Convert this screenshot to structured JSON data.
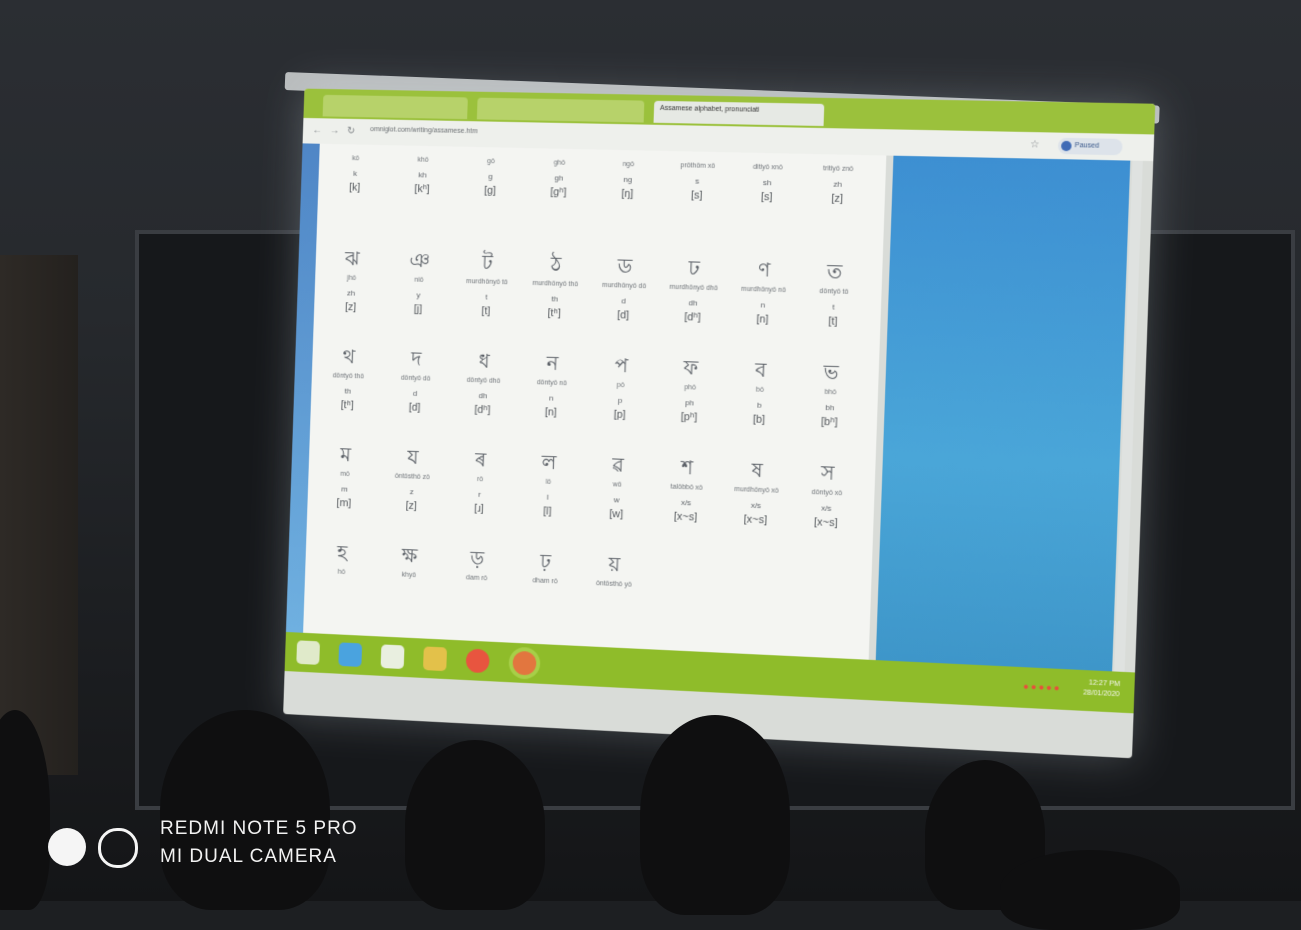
{
  "browser": {
    "tabs": [
      {
        "label": ""
      },
      {
        "label": ""
      },
      {
        "label": "Assamese alphabet, pronunciati"
      }
    ],
    "url": "omniglot.com/writing/assamese.htm",
    "profile_label": "Paused"
  },
  "alphabet_rows": [
    [
      {
        "glyph": "",
        "name": "kô",
        "roman": "k",
        "ipa": "[k]"
      },
      {
        "glyph": "",
        "name": "khô",
        "roman": "kh",
        "ipa": "[kʰ]"
      },
      {
        "glyph": "",
        "name": "gô",
        "roman": "g",
        "ipa": "[g]"
      },
      {
        "glyph": "",
        "name": "ghô",
        "roman": "gh",
        "ipa": "[gʰ]"
      },
      {
        "glyph": "",
        "name": "ngô",
        "roman": "ng",
        "ipa": "[ŋ]"
      },
      {
        "glyph": "",
        "name": "prôthôm xô",
        "roman": "s",
        "ipa": "[s]"
      },
      {
        "glyph": "",
        "name": "ditiyô xnô",
        "roman": "sh",
        "ipa": "[s]"
      },
      {
        "glyph": "",
        "name": "tritiyô znô",
        "roman": "zh",
        "ipa": "[z]"
      }
    ],
    [
      {
        "glyph": "ঝ",
        "name": "jhô",
        "roman": "zh",
        "ipa": "[z]"
      },
      {
        "glyph": "ঞ",
        "name": "niô",
        "roman": "y",
        "ipa": "[j]"
      },
      {
        "glyph": "ট",
        "name": "murdhônyô tô",
        "roman": "t",
        "ipa": "[t]"
      },
      {
        "glyph": "ঠ",
        "name": "murdhônyô thô",
        "roman": "th",
        "ipa": "[tʰ]"
      },
      {
        "glyph": "ড",
        "name": "murdhônyô dô",
        "roman": "d",
        "ipa": "[d]"
      },
      {
        "glyph": "ঢ",
        "name": "murdhônyô dhô",
        "roman": "dh",
        "ipa": "[dʰ]"
      },
      {
        "glyph": "ণ",
        "name": "murdhônyô nô",
        "roman": "n",
        "ipa": "[n]"
      },
      {
        "glyph": "ত",
        "name": "dôntyô tô",
        "roman": "t",
        "ipa": "[t]"
      }
    ],
    [
      {
        "glyph": "থ",
        "name": "dôntyô thô",
        "roman": "th",
        "ipa": "[tʰ]"
      },
      {
        "glyph": "দ",
        "name": "dôntyô dô",
        "roman": "d",
        "ipa": "[d]"
      },
      {
        "glyph": "ধ",
        "name": "dôntyô dhô",
        "roman": "dh",
        "ipa": "[dʰ]"
      },
      {
        "glyph": "ন",
        "name": "dôntyô nô",
        "roman": "n",
        "ipa": "[n]"
      },
      {
        "glyph": "প",
        "name": "pô",
        "roman": "p",
        "ipa": "[p]"
      },
      {
        "glyph": "ফ",
        "name": "phô",
        "roman": "ph",
        "ipa": "[pʰ]"
      },
      {
        "glyph": "ব",
        "name": "bô",
        "roman": "b",
        "ipa": "[b]"
      },
      {
        "glyph": "ভ",
        "name": "bhô",
        "roman": "bh",
        "ipa": "[bʰ]"
      }
    ],
    [
      {
        "glyph": "ম",
        "name": "mô",
        "roman": "m",
        "ipa": "[m]"
      },
      {
        "glyph": "য",
        "name": "ôntôsthô zô",
        "roman": "z",
        "ipa": "[z]"
      },
      {
        "glyph": "ৰ",
        "name": "rô",
        "roman": "r",
        "ipa": "[ɹ]"
      },
      {
        "glyph": "ল",
        "name": "lô",
        "roman": "l",
        "ipa": "[l]"
      },
      {
        "glyph": "ৱ",
        "name": "wô",
        "roman": "w",
        "ipa": "[w]"
      },
      {
        "glyph": "শ",
        "name": "talôbbô xô",
        "roman": "x/s",
        "ipa": "[x~s]"
      },
      {
        "glyph": "ষ",
        "name": "murdhônyô xô",
        "roman": "x/s",
        "ipa": "[x~s]"
      },
      {
        "glyph": "স",
        "name": "dôntyô xô",
        "roman": "x/s",
        "ipa": "[x~s]"
      }
    ],
    [
      {
        "glyph": "হ",
        "name": "hô",
        "roman": "",
        "ipa": ""
      },
      {
        "glyph": "ক্ষ",
        "name": "khyô",
        "roman": "",
        "ipa": ""
      },
      {
        "glyph": "ড়",
        "name": "dam rô",
        "roman": "",
        "ipa": ""
      },
      {
        "glyph": "ঢ়",
        "name": "dham rô",
        "roman": "",
        "ipa": ""
      },
      {
        "glyph": "য়",
        "name": "ôntôsthô yô",
        "roman": "",
        "ipa": ""
      }
    ]
  ],
  "taskbar": {
    "time": "12:27 PM",
    "date": "28/01/2020"
  },
  "watermark": {
    "line1": "REDMI NOTE 5 PRO",
    "line2": "MI DUAL CAMERA"
  }
}
